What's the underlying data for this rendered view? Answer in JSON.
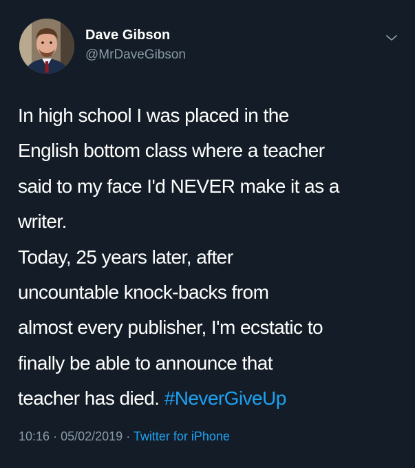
{
  "tweet": {
    "author": {
      "display_name": "Dave Gibson",
      "handle": "@MrDaveGibson"
    },
    "body_lines": [
      "In high school I was placed in the",
      "English bottom class where a teacher",
      "said to my face I'd NEVER make it as a",
      "writer.",
      "Today, 25 years later, after",
      "uncountable knock-backs from",
      "almost every publisher, I'm ecstatic to",
      "finally be able to announce that",
      "teacher has died."
    ],
    "hashtag": "#NeverGiveUp",
    "time": "10:16",
    "date": "05/02/2019",
    "separator": "·",
    "source": "Twitter for iPhone"
  },
  "icons": {
    "menu": "chevron-down-icon",
    "avatar": "profile-photo"
  },
  "colors": {
    "background": "#141d27",
    "text": "#ffffff",
    "secondary": "#8899a6",
    "link": "#1da1f2"
  }
}
